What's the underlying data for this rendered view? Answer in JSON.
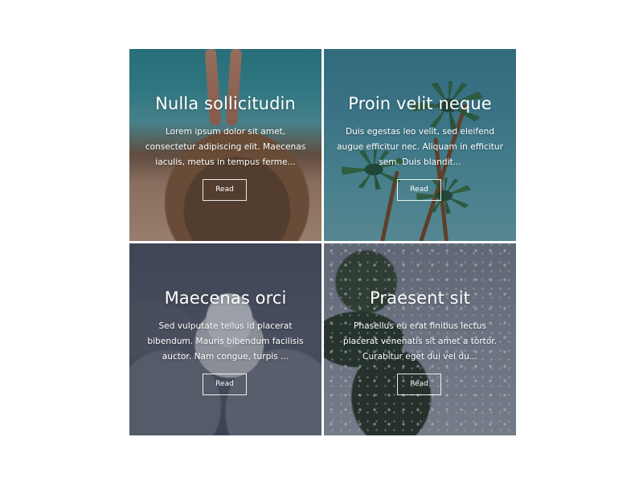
{
  "cards": [
    {
      "title": "Nulla sollicitudin",
      "text": "Lorem ipsum dolor sit amet, consectetur adipiscing elit. Maecenas iaculis, metus in tempus ferme...",
      "button": "Read"
    },
    {
      "title": "Proin velit neque",
      "text": "Duis egestas leo velit, sed eleifend augue efficitur nec. Aliquam in efficitur sem. Duis blandit...",
      "button": "Read"
    },
    {
      "title": "Maecenas orci",
      "text": "Sed vulputate tellus id placerat bibendum. Mauris bibendum facilisis auctor. Nam congue, turpis ...",
      "button": "Read"
    },
    {
      "title": "Praesent sit",
      "text": "Phasellus eu erat finibus lectus placerat venenatis sit amet a tortor. Curabitur eget dui vel du...",
      "button": "Read"
    }
  ],
  "colors": {
    "card_border": "#ffffff",
    "text": "#ffffff",
    "overlay": "rgba(20,30,40,0.28)"
  }
}
